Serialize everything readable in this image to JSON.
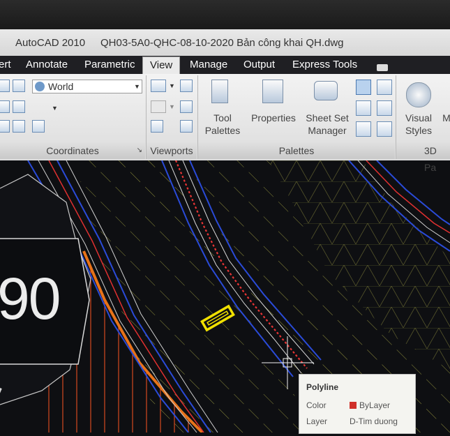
{
  "window": {
    "app_name": "AutoCAD 2010",
    "file_name": "QH03-5A0-QHC-08-10-2020 Bản công khai QH.dwg"
  },
  "ribbon_tabs": [
    {
      "label": "ert",
      "active": false
    },
    {
      "label": "Annotate",
      "active": false
    },
    {
      "label": "Parametric",
      "active": false
    },
    {
      "label": "View",
      "active": true
    },
    {
      "label": "Manage",
      "active": false
    },
    {
      "label": "Output",
      "active": false
    },
    {
      "label": "Express Tools",
      "active": false
    }
  ],
  "coordinates_panel": {
    "ucs_value": "World",
    "title": "Coordinates"
  },
  "viewports_panel": {
    "title": "Viewports"
  },
  "palettes_panel": {
    "title": "Palettes",
    "tool_palettes_line1": "Tool",
    "tool_palettes_line2": "Palettes",
    "properties": "Properties",
    "sheet_set_line1": "Sheet Set",
    "sheet_set_line2": "Manager"
  },
  "visual_styles_panel": {
    "label_line1": "Visual",
    "label_line2": "Styles",
    "next_label": "M",
    "title": "3D Pa"
  },
  "drawing": {
    "label": "90"
  },
  "tooltip": {
    "title": "Polyline",
    "color_label": "Color",
    "color_value": "ByLayer",
    "layer_label": "Layer",
    "layer_value": "D-Tim duong"
  },
  "colors": {
    "hatch": "#9a9a3a",
    "road_edge": "#2a4bd8",
    "centerline": "#e03030",
    "boundary": "#e8731a",
    "selection": "#f0e000",
    "canvas_bg": "#0e0f12"
  }
}
